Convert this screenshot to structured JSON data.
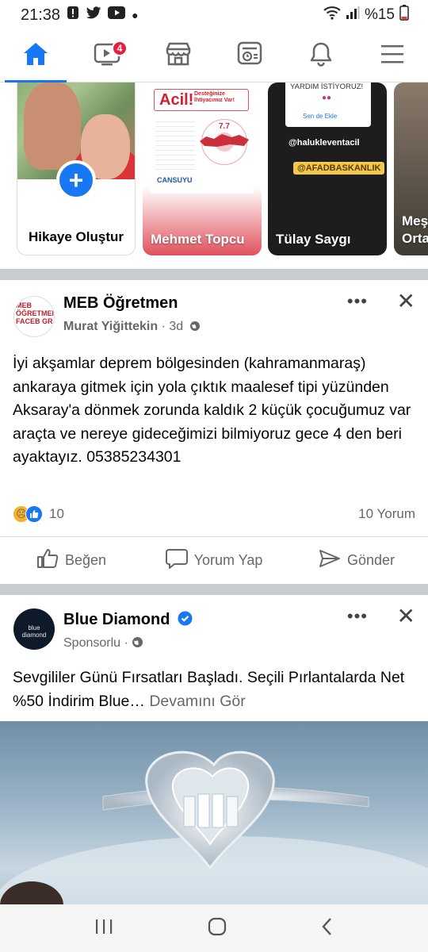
{
  "status_bar": {
    "time": "21:38",
    "battery": "%15"
  },
  "nav": {
    "video_badge": "4"
  },
  "stories": [
    {
      "label": "Hikaye Oluştur"
    },
    {
      "label": "Mehmet Topcu",
      "poster_headline": "Acil!",
      "poster_sub": "Desteğinize İhtiyacımız Var!",
      "poster_brand": "CANSUYU",
      "poster_magnitude": "7.7"
    },
    {
      "label": "Tülay Saygı",
      "help_text": "YARDIM İSTİYORUZ!",
      "add_text": "Sen de Ekle",
      "mention1": "@halukleventacil",
      "mention2": "@AFADBASKANLIK"
    },
    {
      "label": "Meş Orta"
    }
  ],
  "post1": {
    "group": "MEB Öğretmen",
    "author": "Murat Yiğittekin",
    "time": "3d",
    "avatar_text": "MEB ÖĞRETMEN FACEB GR",
    "text": "İyi akşamlar deprem bölgesinden (kahramanmaraş) ankaraya gitmek için yola çıktık maalesef tipi yüzünden Aksaray'a  dönmek zorunda kaldık 2 küçük çocuğumuz var araçta ve nereye gideceğimizi bilmiyoruz  gece 4 den beri ayaktayız. 05385234301",
    "reaction_count": "10",
    "comments": "10 Yorum",
    "actions": {
      "like": "Beğen",
      "comment": "Yorum Yap",
      "send": "Gönder"
    }
  },
  "post2": {
    "name": "Blue Diamond",
    "sponsored": "Sponsorlu",
    "avatar_text": "blue diamond",
    "text": "Sevgililer Günü Fırsatları Başladı. Seçili Pırlantalarda Net %50 İndirim Blue…",
    "see_more": "Devamını Gör"
  },
  "colors": {
    "brand": "#1877f2",
    "badge": "#e41e3f",
    "secondary_text": "#65676b"
  }
}
